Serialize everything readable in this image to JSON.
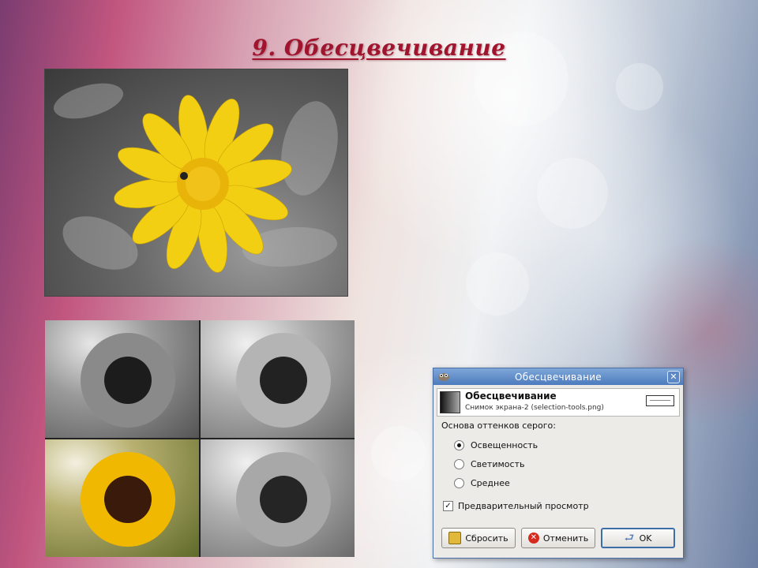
{
  "slide": {
    "title": "9. Обесцвечивание"
  },
  "dialog": {
    "window_title": "Обесцвечивание",
    "header_title": "Обесцвечивание",
    "header_subtitle": "Снимок экрана-2 (selection-tools.png)",
    "section_label": "Основа оттенков серого:",
    "options": [
      {
        "label": "Освещенность",
        "selected": true
      },
      {
        "label": "Светимость",
        "selected": false
      },
      {
        "label": "Среднее",
        "selected": false
      }
    ],
    "preview_label": "Предварительный просмотр",
    "preview_checked": true,
    "buttons": {
      "reset": "Сбросить",
      "cancel": "Отменить",
      "ok": "OK"
    },
    "icons": {
      "window": "gimp-icon",
      "close": "close-icon",
      "reset": "reset-icon",
      "cancel": "cancel-icon",
      "ok": "ok-arrow-icon"
    },
    "colors": {
      "titlebar": "#4d7bbd",
      "cancel_icon": "#d62a1e",
      "reset_icon": "#e0b93a"
    }
  }
}
